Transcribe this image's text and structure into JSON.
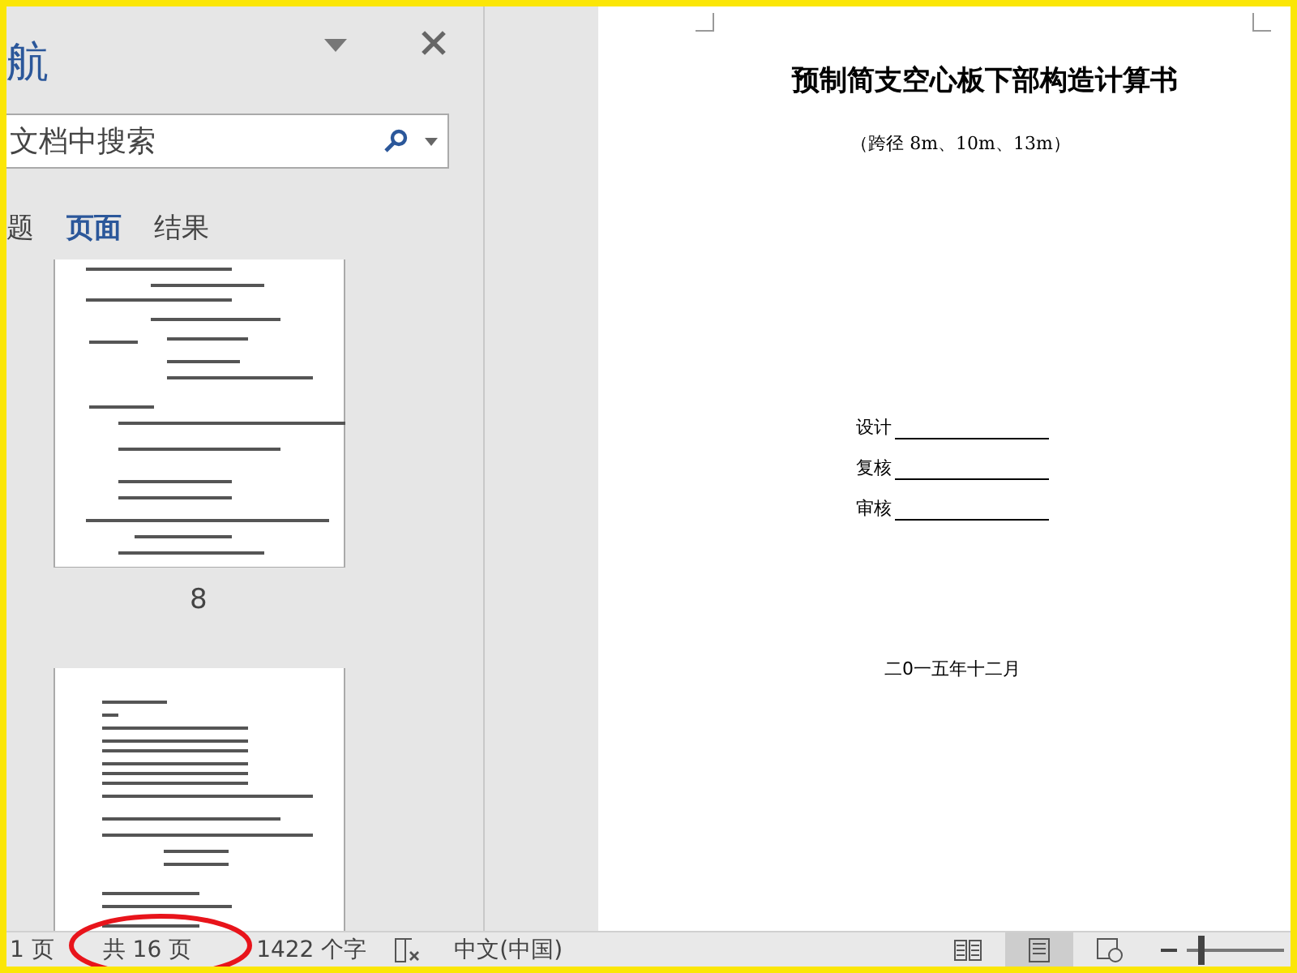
{
  "navigation_pane": {
    "title": "航",
    "search": {
      "placeholder": "文档中搜索"
    },
    "tabs": [
      {
        "label": "题",
        "selected": false
      },
      {
        "label": "页面",
        "selected": true
      },
      {
        "label": "结果",
        "selected": false
      }
    ],
    "thumbnails": [
      {
        "kind": "formulas",
        "label": "8"
      },
      {
        "kind": "list"
      }
    ]
  },
  "document": {
    "title": "预制简支空心板下部构造计算书",
    "subtitle": "（跨径 8m、10m、13m）",
    "signatures": [
      {
        "label": "设计"
      },
      {
        "label": "复核"
      },
      {
        "label": "审核"
      }
    ],
    "date": "二0一五年十二月"
  },
  "status_bar": {
    "page": "1 页",
    "page_count": "共 16 页",
    "word_count": "1422 个字",
    "language": "中文(中国)",
    "views": [
      {
        "kind": "read",
        "selected": false
      },
      {
        "kind": "print",
        "selected": true
      },
      {
        "kind": "web",
        "selected": false
      }
    ],
    "zoom": {
      "level": 0.15
    }
  }
}
